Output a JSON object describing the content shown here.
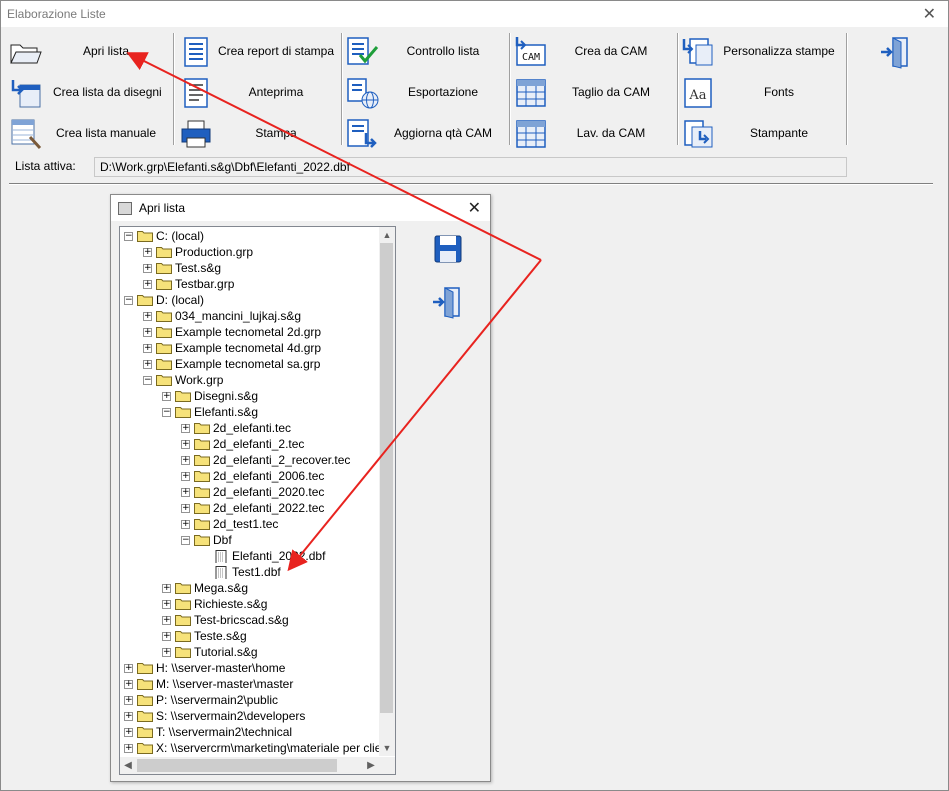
{
  "window": {
    "title": "Elaborazione Liste"
  },
  "toolbar": {
    "col1": [
      "Apri lista",
      "Crea lista da disegni",
      "Crea lista manuale"
    ],
    "col2": [
      "Crea report di stampa",
      "Anteprima",
      "Stampa"
    ],
    "col3": [
      "Controllo lista",
      "Esportazione",
      "Aggiorna qtà CAM"
    ],
    "col4": [
      "Crea da CAM",
      "Taglio da CAM",
      "Lav. da CAM"
    ],
    "col5": [
      "Personalizza stampe",
      "Fonts",
      "Stampante"
    ],
    "cam_icon_text": "CAM",
    "fonts_icon_text": "Aa"
  },
  "lista_attiva": {
    "label": "Lista attiva:",
    "value": "D:\\Work.grp\\Elefanti.s&g\\Dbf\\Elefanti_2022.dbf"
  },
  "dialog": {
    "title": "Apri lista",
    "tree": [
      {
        "label": "C: (local)",
        "expanded": true,
        "type": "folder"
      },
      {
        "label": "Production.grp",
        "expanded": false,
        "type": "folder"
      },
      {
        "label": "Test.s&g",
        "expanded": false,
        "type": "folder"
      },
      {
        "label": "Testbar.grp",
        "expanded": false,
        "type": "folder"
      },
      {
        "label": "D: (local)",
        "expanded": true,
        "type": "folder"
      },
      {
        "label": "034_mancini_lujkaj.s&g",
        "expanded": false,
        "type": "folder"
      },
      {
        "label": "Example tecnometal 2d.grp",
        "expanded": false,
        "type": "folder"
      },
      {
        "label": "Example tecnometal 4d.grp",
        "expanded": false,
        "type": "folder"
      },
      {
        "label": "Example tecnometal sa.grp",
        "expanded": false,
        "type": "folder"
      },
      {
        "label": "Work.grp",
        "expanded": true,
        "type": "folder"
      },
      {
        "label": "Disegni.s&g",
        "expanded": false,
        "type": "folder"
      },
      {
        "label": "Elefanti.s&g",
        "expanded": true,
        "type": "folder"
      },
      {
        "label": "2d_elefanti.tec",
        "expanded": false,
        "type": "folder"
      },
      {
        "label": "2d_elefanti_2.tec",
        "expanded": false,
        "type": "folder"
      },
      {
        "label": "2d_elefanti_2_recover.tec",
        "expanded": false,
        "type": "folder"
      },
      {
        "label": "2d_elefanti_2006.tec",
        "expanded": false,
        "type": "folder"
      },
      {
        "label": "2d_elefanti_2020.tec",
        "expanded": false,
        "type": "folder"
      },
      {
        "label": "2d_elefanti_2022.tec",
        "expanded": false,
        "type": "folder"
      },
      {
        "label": "2d_test1.tec",
        "expanded": false,
        "type": "folder"
      },
      {
        "label": "Dbf",
        "expanded": true,
        "type": "folder"
      },
      {
        "label": "Elefanti_2022.dbf",
        "type": "file"
      },
      {
        "label": "Test1.dbf",
        "type": "file"
      },
      {
        "label": "Mega.s&g",
        "expanded": false,
        "type": "folder"
      },
      {
        "label": "Richieste.s&g",
        "expanded": false,
        "type": "folder"
      },
      {
        "label": "Test-bricscad.s&g",
        "expanded": false,
        "type": "folder"
      },
      {
        "label": "Teste.s&g",
        "expanded": false,
        "type": "folder"
      },
      {
        "label": "Tutorial.s&g",
        "expanded": false,
        "type": "folder"
      },
      {
        "label": "H: \\\\server-master\\home",
        "expanded": false,
        "type": "folder"
      },
      {
        "label": "M: \\\\server-master\\master",
        "expanded": false,
        "type": "folder"
      },
      {
        "label": "P: \\\\servermain2\\public",
        "expanded": false,
        "type": "folder"
      },
      {
        "label": "S: \\\\servermain2\\developers",
        "expanded": false,
        "type": "folder"
      },
      {
        "label": "T: \\\\servermain2\\technical",
        "expanded": false,
        "type": "folder"
      },
      {
        "label": "X: \\\\servercrm\\marketing\\materiale per clienti\\",
        "expanded": false,
        "type": "folder"
      }
    ]
  },
  "colors": {
    "annotation_arrow": "#e8231f",
    "folder": "#f6e27a",
    "icon_blue": "#1f5fbf"
  }
}
